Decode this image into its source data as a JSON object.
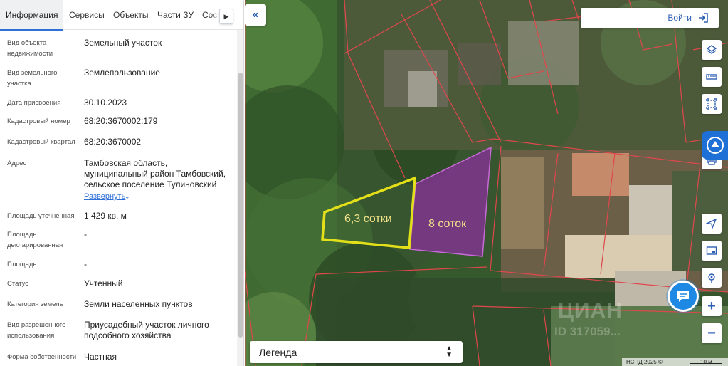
{
  "tabs": [
    {
      "label": "Информация",
      "active": true
    },
    {
      "label": "Сервисы"
    },
    {
      "label": "Объекты"
    },
    {
      "label": "Части ЗУ"
    },
    {
      "label": "Соста"
    }
  ],
  "tab_scroll_icon": "chevron-right-icon",
  "details": [
    {
      "label": "Вид объекта недвижимости",
      "value": "Земельный участок"
    },
    {
      "label": "Вид земельного участка",
      "value": "Землепользование"
    },
    {
      "label": "Дата присвоения",
      "value": "30.10.2023"
    },
    {
      "label": "Кадастровый номер",
      "value": "68:20:3670002:179"
    },
    {
      "label": "Кадастровый квартал",
      "value": "68:20:3670002"
    },
    {
      "label": "Адрес",
      "value": "Тамбовская область, муниципальный район Тамбовский, сельское поселение Тулиновский"
    },
    {
      "label": "Площадь уточненная",
      "value": "1 429 кв. м"
    },
    {
      "label": "Площадь декларированная",
      "value": "-"
    },
    {
      "label": "Площадь",
      "value": "-"
    },
    {
      "label": "Статус",
      "value": "Учтенный"
    },
    {
      "label": "Категория земель",
      "value": "Земли населенных пунктов"
    },
    {
      "label": "Вид разрешенного использования",
      "value": "Приусадебный участок личного подсобного хозяйства"
    },
    {
      "label": "Форма собственности",
      "value": "Частная"
    }
  ],
  "expand_link": "Развернуть",
  "map": {
    "login_label": "Войти",
    "legend_label": "Легенда",
    "parcel_label_small": "6,3 сотки",
    "parcel_label_large": "8 соток",
    "watermark_top": "ЦИАН",
    "watermark_id": "ID 317059...",
    "scale_copyright": "НСПД 2025 ©",
    "scale_distance": "10 м",
    "colors": {
      "parcel_selected_fill": "#8d2fa0",
      "parcel_selected_border": "#c86ad8",
      "parcel_outline_yellow": "#e3e01a",
      "cadastre_border": "#e0474c",
      "accent": "#2f5fb3",
      "fab": "#1e88e5"
    },
    "controls": [
      "layers-icon",
      "ruler-icon",
      "select-area-icon",
      "print-icon",
      "locate-icon",
      "picture-in-picture-icon",
      "geo-target-icon",
      "zoom-in-icon",
      "zoom-out-icon"
    ],
    "zoom_in": "+",
    "zoom_out": "−"
  }
}
